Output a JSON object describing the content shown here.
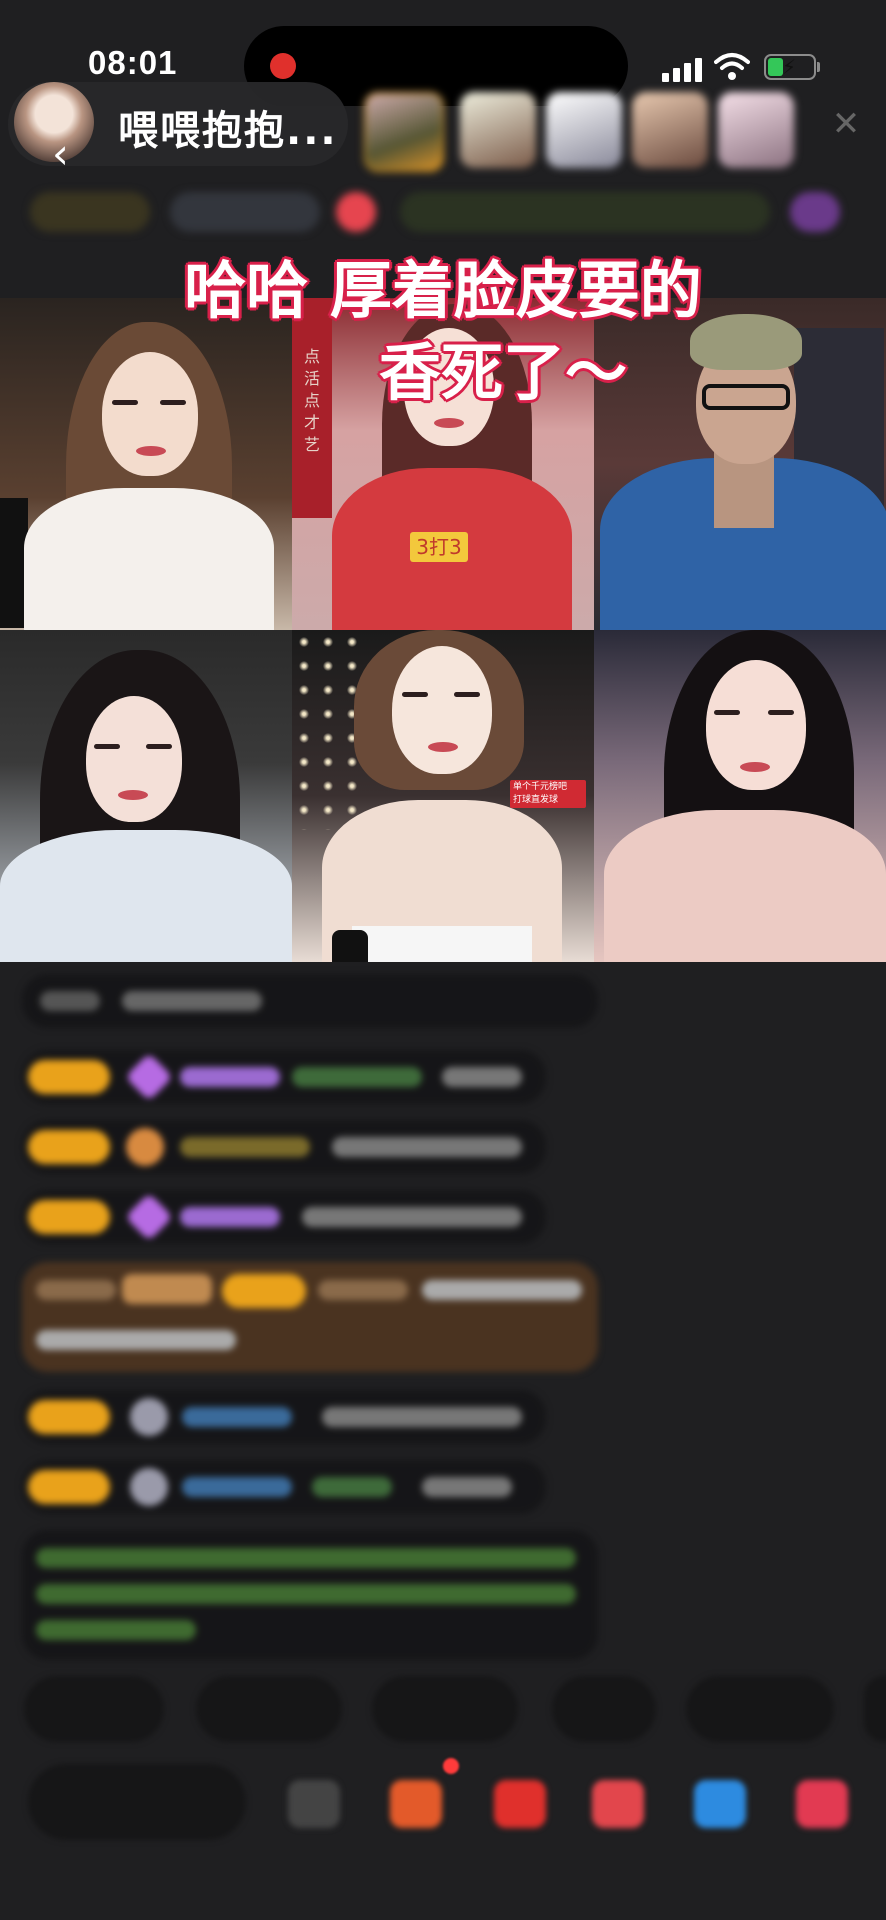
{
  "status_bar": {
    "time": "08:01",
    "recording_color": "#e0302c",
    "battery_fraction": 0.35,
    "battery_charging": true
  },
  "header": {
    "host_name": "喂喂抱抱...",
    "back_icon": "chevron-left-icon",
    "close_icon": "close-icon",
    "viewer_avatar_count": 5
  },
  "overlay": {
    "line1": "哈哈 厚着脸皮要的",
    "line2": "香死了～",
    "stroke_color": "#d8204a"
  },
  "video_grid": {
    "tiles": [
      {
        "tag": ""
      },
      {
        "tag": "3打3",
        "side_text": "点活点才艺"
      },
      {
        "tag": ""
      },
      {
        "tag": ""
      },
      {
        "tag": "单个千元榜吧\n打球直发球"
      },
      {
        "tag": ""
      }
    ]
  },
  "colors": {
    "background": "#1f1f21",
    "badge": "#e9a21b",
    "gem": "#b66be3",
    "chat_highlight": "#4a3320"
  }
}
